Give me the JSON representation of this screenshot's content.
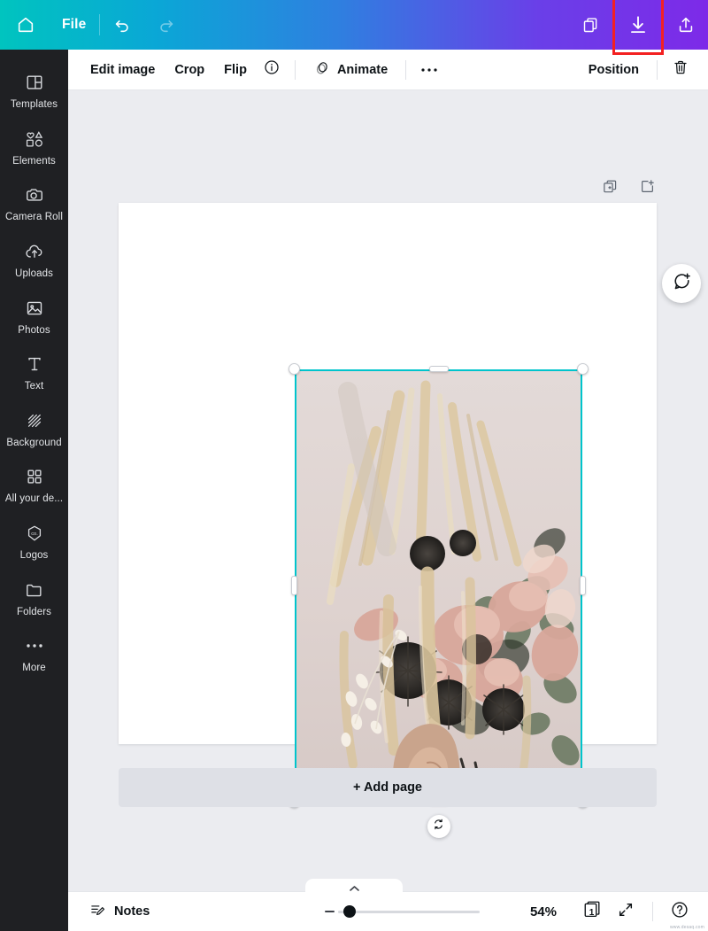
{
  "topbar": {
    "home_label": "home-icon",
    "file_label": "File",
    "undo_label": "undo-icon",
    "redo_label": "redo-icon",
    "duplicate_label": "duplicate-icon",
    "download_label": "download-icon",
    "share_label": "share-icon",
    "highlight_color": "#f32121",
    "gradient_start": "#00c4bf",
    "gradient_end": "#7d2ae8"
  },
  "sidebar": {
    "items": [
      {
        "label": "Templates",
        "icon": "templates-icon"
      },
      {
        "label": "Elements",
        "icon": "elements-icon"
      },
      {
        "label": "Camera Roll",
        "icon": "camera-icon"
      },
      {
        "label": "Uploads",
        "icon": "upload-cloud-icon"
      },
      {
        "label": "Photos",
        "icon": "photo-icon"
      },
      {
        "label": "Text",
        "icon": "text-icon"
      },
      {
        "label": "Background",
        "icon": "background-icon"
      },
      {
        "label": "All your de...",
        "icon": "grid-icon"
      },
      {
        "label": "Logos",
        "icon": "logos-icon"
      },
      {
        "label": "Folders",
        "icon": "folder-icon"
      },
      {
        "label": "More",
        "icon": "more-dots-icon"
      }
    ]
  },
  "toolbar": {
    "edit_image_label": "Edit image",
    "crop_label": "Crop",
    "flip_label": "Flip",
    "info_label": "info-icon",
    "animate_label": "Animate",
    "more_label": "•••",
    "position_label": "Position",
    "delete_label": "trash-icon"
  },
  "canvas": {
    "duplicate_page_label": "duplicate-page-icon",
    "add_page_icon_label": "add-page-icon",
    "add_page_label": "+ Add page",
    "comment_label": "add-comment-icon",
    "rotate_label": "rotate-icon",
    "selection_color": "#00c4cc",
    "page_background": "#ffffff",
    "workspace_background": "#ebecf0"
  },
  "bottombar": {
    "notes_label": "Notes",
    "zoom_value": "54%",
    "zoom_percent": 54,
    "page_number": "1",
    "page_count_label": "page-count-icon",
    "fullscreen_label": "fullscreen-icon",
    "help_label": "help-icon",
    "watermark": "www.desaq.com",
    "panel_tab_label": "chevron-up-icon"
  }
}
